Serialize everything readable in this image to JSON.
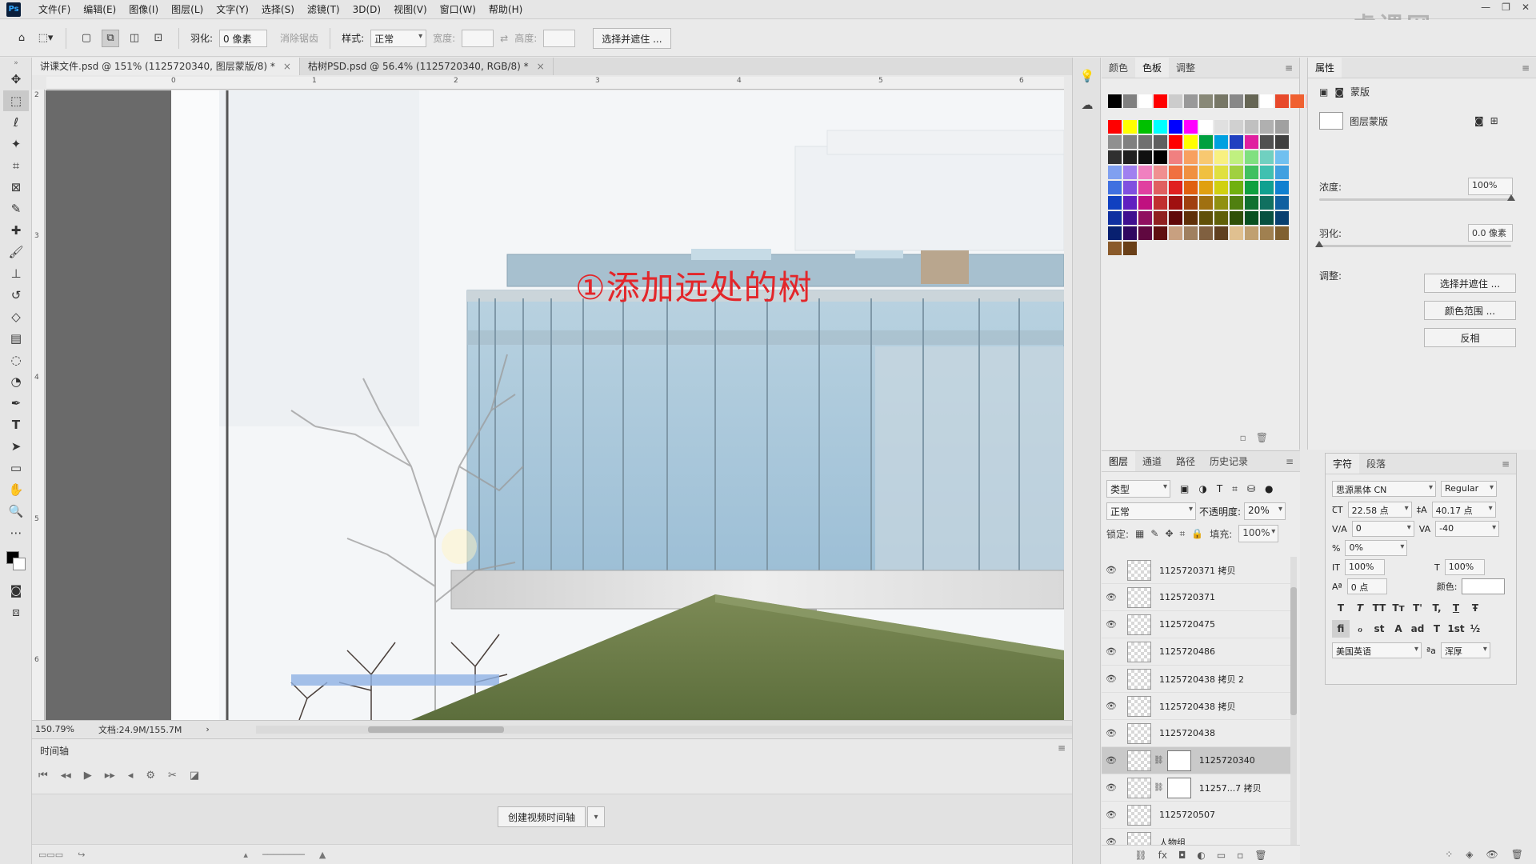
{
  "app": {
    "logo": "Ps"
  },
  "menu": [
    "文件(F)",
    "编辑(E)",
    "图像(I)",
    "图层(L)",
    "文字(Y)",
    "选择(S)",
    "滤镜(T)",
    "3D(D)",
    "视图(V)",
    "窗口(W)",
    "帮助(H)"
  ],
  "watermark": "虎课网",
  "options": {
    "feather_label": "羽化:",
    "feather_value": "0 像素",
    "antialias_label": "消除锯齿",
    "style_label": "样式:",
    "style_value": "正常",
    "width_label": "宽度:",
    "height_label": "高度:",
    "select_mask_button": "选择并遮住 ..."
  },
  "tabs": [
    {
      "label": "讲课文件.psd @ 151% (1125720340, 图层蒙版/8) *",
      "close": "×"
    },
    {
      "label": "枯树PSD.psd @ 56.4% (1125720340, RGB/8) *",
      "close": "×"
    }
  ],
  "ruler": {
    "h": [
      "0",
      "1",
      "2",
      "3",
      "4",
      "5",
      "6"
    ],
    "v": [
      "2",
      "3",
      "4",
      "5",
      "6"
    ]
  },
  "canvas": {
    "caption": "①添加远处的树"
  },
  "status": {
    "zoom": "150.79%",
    "doc": "文档:24.9M/155.7M",
    "arrow": "›"
  },
  "timeline": {
    "title": "时间轴",
    "create_button": "创建视频时间轴",
    "dropdown": "▾",
    "menu": "≡"
  },
  "swatches": {
    "tabs": [
      "颜色",
      "色板",
      "调整"
    ],
    "recent": [
      "#000000",
      "#808080",
      "#ffffff",
      "#ff0000",
      "#cccccc",
      "#999999",
      "#888877",
      "#777766",
      "#888888",
      "#666655",
      "#ffffff",
      "#e84a2c",
      "#f06030",
      "#f7c8c8",
      "#f4e0c0"
    ],
    "grid": [
      "#ff0000",
      "#ffff00",
      "#00c000",
      "#00ffff",
      "#0000ff",
      "#ff00ff",
      "#ffffff",
      "#e0e0e0",
      "#d0d0d0",
      "#c0c0c0",
      "#b0b0b0",
      "#a0a0a0",
      "#909090",
      "#808080",
      "#707070",
      "#606060",
      "#ff0000",
      "#ffff00",
      "#00a040",
      "#00a0e0",
      "#2040c0",
      "#e020a0",
      "#505050",
      "#404040",
      "#303030",
      "#202020",
      "#101010",
      "#000000",
      "#f08080",
      "#f8a060",
      "#f8c870",
      "#f8f080",
      "#c0f080",
      "#80e080",
      "#70d0c0",
      "#70c0f0",
      "#80a0f0",
      "#a080f0",
      "#f080c0",
      "#f09090",
      "#f07040",
      "#f09040",
      "#f0c040",
      "#e0e040",
      "#a0d040",
      "#40c060",
      "#40c0b0",
      "#40a0e0",
      "#4070e0",
      "#8050e0",
      "#e040a0",
      "#e06060",
      "#e02020",
      "#e06010",
      "#e0a010",
      "#d0d010",
      "#70b010",
      "#10a040",
      "#10a090",
      "#1080d0",
      "#1040c0",
      "#6020c0",
      "#c01080",
      "#c03030",
      "#a01010",
      "#a04010",
      "#a07010",
      "#909010",
      "#508010",
      "#107030",
      "#107060",
      "#1060a0",
      "#1030a0",
      "#401090",
      "#901060",
      "#902020",
      "#600808",
      "#603008",
      "#605008",
      "#606008",
      "#305008",
      "#085020",
      "#085040",
      "#084070",
      "#082070",
      "#300860",
      "#600840",
      "#601010",
      "#c8a080",
      "#a08060",
      "#806040",
      "#604020",
      "#e0c090",
      "#c0a070",
      "#a08050",
      "#806030",
      "#8a5a2a",
      "#6a4018"
    ],
    "foot": [
      "▫",
      "🗑"
    ]
  },
  "layers": {
    "tabs": [
      "图层",
      "通道",
      "路径",
      "历史记录"
    ],
    "filter": "类型",
    "blend_mode": "正常",
    "opacity_label": "不透明度:",
    "opacity_value": "20%",
    "lock_label": "锁定:",
    "fill_label": "填充:",
    "fill_value": "100%",
    "items": [
      {
        "name": "1125720371 拷贝",
        "mask": false,
        "selected": false
      },
      {
        "name": "1125720371",
        "mask": false,
        "selected": false
      },
      {
        "name": "1125720475",
        "mask": false,
        "selected": false
      },
      {
        "name": "1125720486",
        "mask": false,
        "selected": false
      },
      {
        "name": "1125720438 拷贝 2",
        "mask": false,
        "selected": false
      },
      {
        "name": "1125720438 拷贝",
        "mask": false,
        "selected": false
      },
      {
        "name": "1125720438",
        "mask": false,
        "selected": false
      },
      {
        "name": "1125720340",
        "mask": true,
        "selected": true
      },
      {
        "name": "11257...7 拷贝",
        "mask": true,
        "selected": false
      },
      {
        "name": "1125720507",
        "mask": false,
        "selected": false
      },
      {
        "name": "人物组",
        "mask": false,
        "selected": false
      }
    ],
    "foot": [
      "⛓",
      "fx",
      "◘",
      "◐",
      "▭",
      "▫",
      "🗑"
    ]
  },
  "properties": {
    "title": "属性",
    "mask_type": "蒙版",
    "layer_mask": "图层蒙版",
    "density_label": "浓度:",
    "density_value": "100%",
    "density_level": 1.0,
    "feather_label": "羽化:",
    "feather_value": "0.0 像素",
    "feather_level": 0.0,
    "adjust_label": "调整:",
    "btn_select_mask": "选择并遮住 ...",
    "btn_color_range": "颜色范围 ...",
    "btn_invert": "反相"
  },
  "character": {
    "tabs": [
      "字符",
      "段落"
    ],
    "font": "思源黑体 CN",
    "weight": "Regular",
    "size": "22.58 点",
    "leading": "40.17 点",
    "kerning": "0",
    "tracking": "-40",
    "scale_pct": "0%",
    "v_scale": "100%",
    "h_scale": "100%",
    "baseline": "0 点",
    "color_label": "颜色:",
    "lang": "美国英语",
    "aa": "浑厚",
    "aa_icon": "ªa",
    "style_buttons": [
      "T",
      "T",
      "TT",
      "Tт",
      "T'",
      "T,",
      "T",
      "Ŧ"
    ],
    "ot_buttons": [
      "fi",
      "ℴ",
      "st",
      "A",
      "ad",
      "T",
      "1st",
      "½"
    ]
  }
}
